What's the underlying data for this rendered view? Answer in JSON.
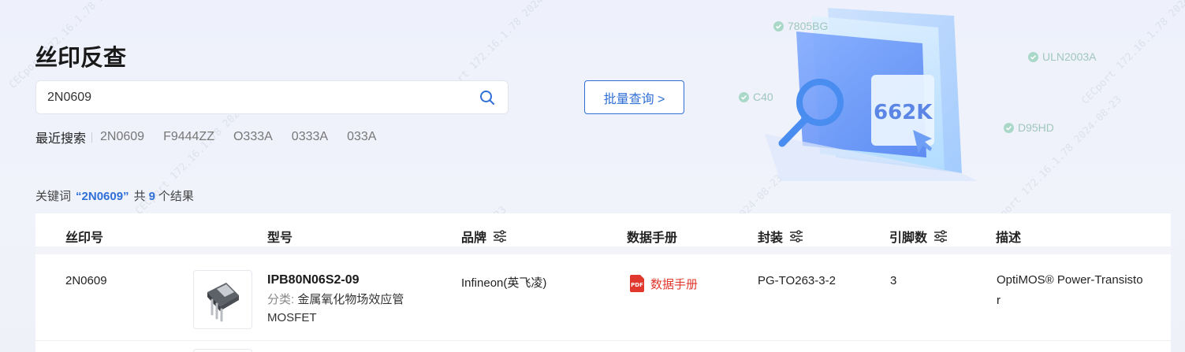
{
  "page": {
    "title": "丝印反查"
  },
  "search": {
    "value": "2N0609",
    "placeholder": ""
  },
  "recent": {
    "label": "最近搜索",
    "items": [
      "2N0609",
      "F9444ZZ",
      "O333A",
      "0333A",
      "033A"
    ]
  },
  "batch_button": {
    "label": "批量查询 >"
  },
  "hero": {
    "count_label": "662K",
    "tags": [
      "7805BG",
      "ULN2003A",
      "C40",
      "D95HD"
    ]
  },
  "result_summary": {
    "prefix": "关键词",
    "keyword": "“2N0609”",
    "middle": "共",
    "count": "9",
    "suffix": "个结果"
  },
  "table": {
    "headers": {
      "marking": "丝印号",
      "model": "型号",
      "brand": "品牌",
      "datasheet": "数据手册",
      "package": "封装",
      "pins": "引脚数",
      "description": "描述"
    },
    "rows": [
      {
        "marking": "2N0609",
        "model": "IPB80N06S2-09",
        "category_label": "分类:",
        "category": "金属氧化物场效应管MOSFET",
        "brand": "Infineon(英飞凌)",
        "datasheet": "数据手册",
        "package": "PG-TO263-3-2",
        "pins": "3",
        "description": "OptiMOS® Power-Transistor"
      }
    ]
  },
  "watermark": {
    "text": "CECport 172.16.1.78 2024-08-23"
  },
  "colors": {
    "accent": "#2f6fd6",
    "datasheet_red": "#e0382d",
    "background": "#eef1fb"
  }
}
